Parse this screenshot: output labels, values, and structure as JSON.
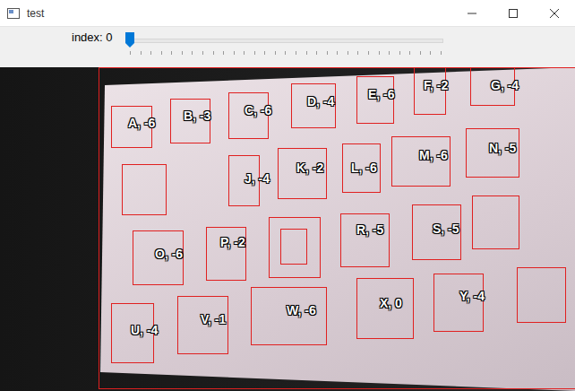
{
  "window": {
    "title": "test"
  },
  "trackbar": {
    "label": "index: 0",
    "level": 0
  },
  "detections": [
    {
      "label": "A, -6"
    },
    {
      "label": "B, -3"
    },
    {
      "label": "C, -6"
    },
    {
      "label": "D, -4"
    },
    {
      "label": "E, -6"
    },
    {
      "label": "F, -2"
    },
    {
      "label": "G, -4"
    },
    {
      "label": "J, -4"
    },
    {
      "label": "K, -2"
    },
    {
      "label": "L, -6"
    },
    {
      "label": "M, -6"
    },
    {
      "label": "N, -5"
    },
    {
      "label": "O, -6"
    },
    {
      "label": "P, -2"
    },
    {
      "label": "R, -5"
    },
    {
      "label": "S, -5"
    },
    {
      "label": "X, 0"
    },
    {
      "label": "Y, -4"
    },
    {
      "label": "U, -4"
    },
    {
      "label": "V, -1"
    },
    {
      "label": "W, -6"
    }
  ]
}
